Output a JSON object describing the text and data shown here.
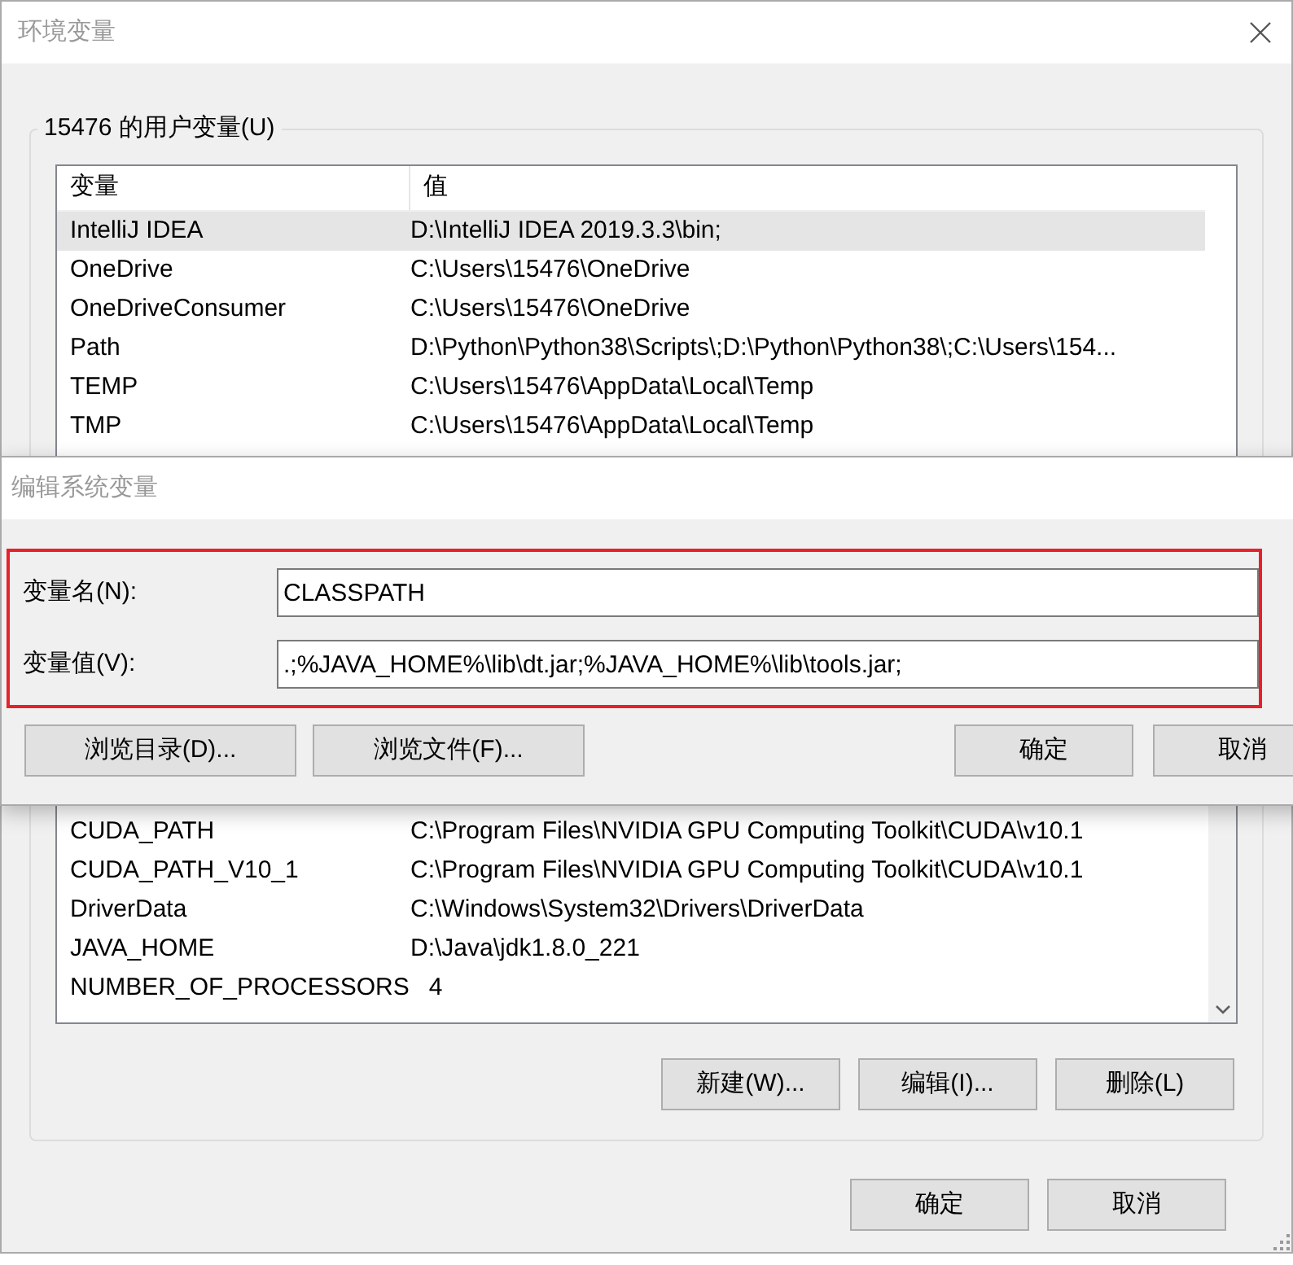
{
  "window": {
    "title": "环境变量"
  },
  "user_group": {
    "title": "15476 的用户变量(U)",
    "columns": [
      "变量",
      "值"
    ],
    "rows": [
      {
        "name": "IntelliJ IDEA",
        "value": "D:\\IntelliJ IDEA 2019.3.3\\bin;",
        "selected": true
      },
      {
        "name": "OneDrive",
        "value": "C:\\Users\\15476\\OneDrive",
        "selected": false
      },
      {
        "name": "OneDriveConsumer",
        "value": "C:\\Users\\15476\\OneDrive",
        "selected": false
      },
      {
        "name": "Path",
        "value": "D:\\Python\\Python38\\Scripts\\;D:\\Python\\Python38\\;C:\\Users\\154...",
        "selected": false
      },
      {
        "name": "TEMP",
        "value": "C:\\Users\\15476\\AppData\\Local\\Temp",
        "selected": false
      },
      {
        "name": "TMP",
        "value": "C:\\Users\\15476\\AppData\\Local\\Temp",
        "selected": false
      }
    ]
  },
  "system_group": {
    "rows": [
      {
        "name": "CUDA_PATH",
        "value": "C:\\Program Files\\NVIDIA GPU Computing Toolkit\\CUDA\\v10.1",
        "selected": false
      },
      {
        "name": "CUDA_PATH_V10_1",
        "value": "C:\\Program Files\\NVIDIA GPU Computing Toolkit\\CUDA\\v10.1",
        "selected": false
      },
      {
        "name": "DriverData",
        "value": "C:\\Windows\\System32\\Drivers\\DriverData",
        "selected": false
      },
      {
        "name": "JAVA_HOME",
        "value": "D:\\Java\\jdk1.8.0_221",
        "selected": false
      },
      {
        "name": "NUMBER_OF_PROCESSORS",
        "value": "4",
        "selected": false
      }
    ],
    "buttons": [
      "新建(W)...",
      "编辑(I)...",
      "删除(L)"
    ]
  },
  "footer_buttons": [
    "确定",
    "取消"
  ],
  "edit_dialog": {
    "title": "编辑系统变量",
    "fields": [
      {
        "label": "变量名(N):",
        "value": "CLASSPATH"
      },
      {
        "label": "变量值(V):",
        "value": ".;%JAVA_HOME%\\lib\\dt.jar;%JAVA_HOME%\\lib\\tools.jar;"
      }
    ],
    "left_buttons": [
      "浏览目录(D)...",
      "浏览文件(F)..."
    ],
    "right_buttons": [
      "确定",
      "取消"
    ]
  }
}
